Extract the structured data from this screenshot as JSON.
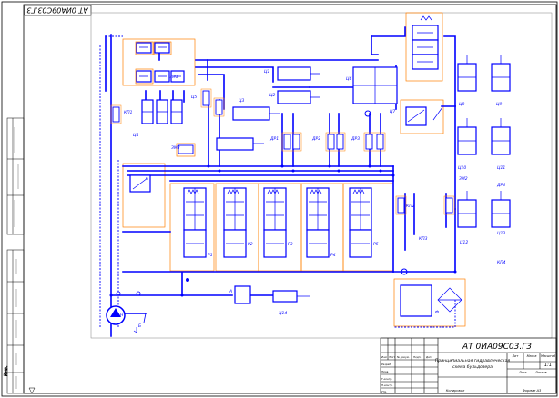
{
  "drawing": {
    "code_rotated": "АТ 0ИА09С03.Г3",
    "title_block": {
      "code": "АТ 0ИА09С03.Г3",
      "name_line1": "Принципиальная гидравлическая",
      "name_line2": "схема бульдозера",
      "lit": "Лит",
      "mass": "Масса",
      "scale": "Масштаб",
      "sheet": "Лист",
      "sheets": "Листов",
      "scale_value": "1:1",
      "sheet_no": "Лист",
      "copied": "Копировал",
      "format": "Формат А3",
      "role_izm": "Изм",
      "role_list": "Лист",
      "role_doc": "№ докум.",
      "role_sign": "Подп.",
      "role_date": "Дата",
      "role_dev": "Разраб.",
      "role_check": "Пров.",
      "role_tcontr": "Т.контр.",
      "role_ncontr": "Н.контр.",
      "role_approved": "Утв."
    }
  },
  "labels": {
    "rp1": "Р1",
    "rp2": "Р2",
    "rp3": "Р3",
    "rp4": "Р4",
    "rp5": "Р5",
    "c1": "Ц1",
    "c2": "Ц2",
    "c3": "Ц3",
    "c4": "Ц4",
    "c5": "Ц5",
    "c6": "Ц6",
    "c7": "Ц7",
    "c8": "Ц8",
    "c9": "Ц9",
    "c10": "Ц10",
    "c11": "Ц11",
    "c12": "Ц12",
    "c13": "Ц13",
    "c14": "Ц14",
    "kp1": "КП1",
    "kp2": "КП2",
    "kp3": "КП3",
    "kp4": "КП4",
    "dr1": "ДР1",
    "dr2": "ДР2",
    "dr3": "ДР3",
    "dr4": "ДР4",
    "zm1": "ЗМ1",
    "zm2": "ЗМ2",
    "zm3": "ЗМ3",
    "n": "Н",
    "f": "Ф",
    "b": "Б",
    "a": "А"
  },
  "colors": {
    "line": "#0000ff",
    "frame": "#000000",
    "group": "#ff8000",
    "thin": "#808080",
    "symbol_fill": "#ffffff"
  }
}
